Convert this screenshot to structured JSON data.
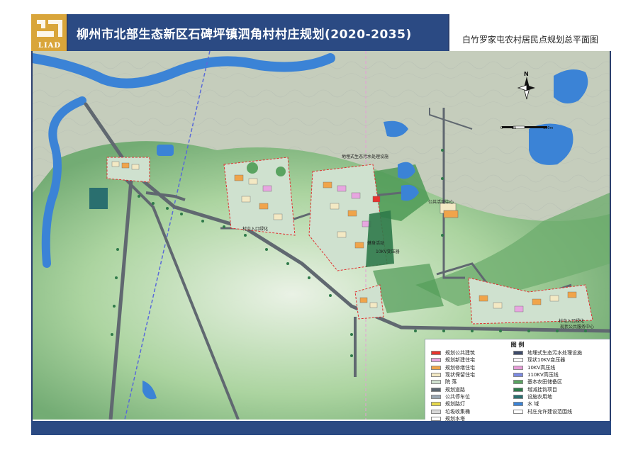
{
  "header": {
    "logo_text": "LIAD",
    "title": "柳州市北部生态新区石碑坪镇泗角村村庄规划(2020-2035)",
    "subtitle": "白竹罗家屯农村居民点规划总平面图"
  },
  "map": {
    "north_letter": "N",
    "scale_labels": [
      "0",
      "25",
      "100m"
    ],
    "labels": [
      {
        "text": "地埋式生态污水处理设施"
      },
      {
        "text": "村屯入口绿化"
      },
      {
        "text": "公共活动中心"
      },
      {
        "text": "健身活动"
      },
      {
        "text": "村屯入口绿化"
      },
      {
        "text": "现状公共服务中心"
      },
      {
        "text": "10KV变压器"
      }
    ],
    "colors": {
      "water": "#3b83d6",
      "greenery": "#7cc27a",
      "farmland": "#4e9a56",
      "road": "#606870",
      "boundary": "#e03030",
      "powerline": "#5a6bd8"
    }
  },
  "legend": {
    "title": "图 例",
    "left_items": [
      {
        "label": "规划公共建筑",
        "color": "#e8342f"
      },
      {
        "label": "规划新建住宅",
        "color": "#e7a6e0"
      },
      {
        "label": "规划修缮住宅",
        "color": "#f0a44a"
      },
      {
        "label": "现状保留住宅",
        "color": "#f3e9c4"
      },
      {
        "label": "院    落",
        "color": "#cfe1cf"
      },
      {
        "label": "规划道路",
        "color": "#5b6670"
      },
      {
        "label": "公共停车位",
        "color": "#9aa7b3"
      },
      {
        "label": "规划路灯",
        "color": "#e6d84a"
      },
      {
        "label": "垃圾收集桶",
        "color": "#d8d8d8"
      },
      {
        "label": "规划水塔",
        "color": "#ffffff"
      }
    ],
    "right_items": [
      {
        "label": "地埋式生态污水处理设施",
        "color": "#3e4b6a"
      },
      {
        "label": "现状10KV变压器",
        "color": "#ffffff"
      },
      {
        "label": "10KV高压线",
        "color": "#e79bd7"
      },
      {
        "label": "110KV高压线",
        "color": "#7c8be2"
      },
      {
        "label": "基本农田储备区",
        "color": "#5aa361"
      },
      {
        "label": "增减挂钩项目",
        "color": "#2f7a4a"
      },
      {
        "label": "设施农用地",
        "color": "#2a6f6f"
      },
      {
        "label": "水    域",
        "color": "#3b83d6"
      },
      {
        "label": "村庄允许建设范围线",
        "color": "#ffffff"
      }
    ]
  }
}
